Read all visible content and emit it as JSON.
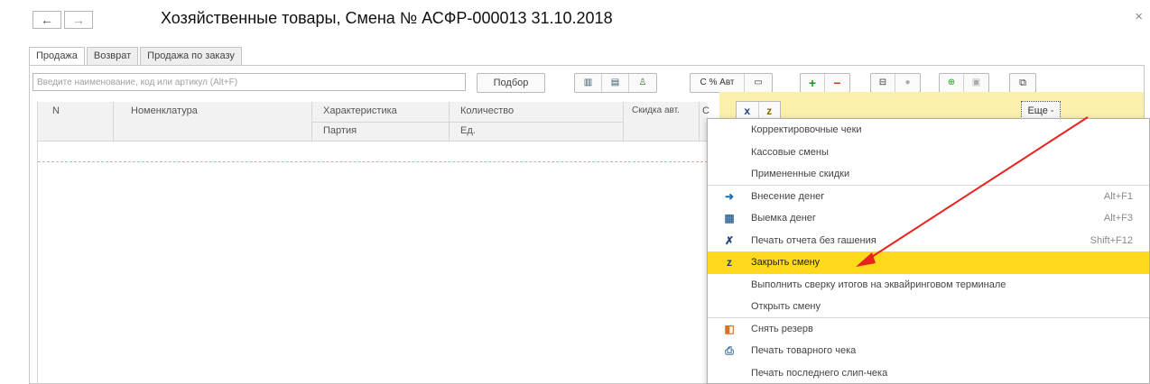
{
  "header": {
    "back_symbol": "←",
    "forward_symbol": "→",
    "title": "Хозяйственные товары, Смена № АСФР-000013  31.10.2018",
    "close_symbol": "×"
  },
  "tabs": [
    {
      "label": "Продажа"
    },
    {
      "label": "Возврат"
    },
    {
      "label": "Продажа по заказу"
    }
  ],
  "toolbar": {
    "search_placeholder": "Введите наименование, код или артикул (Alt+F)",
    "podbor_label": "Подбор",
    "discount_label": "С % Авт",
    "plus_symbol": "+",
    "minus_symbol": "−"
  },
  "grid": {
    "col_n": "N",
    "col_nomenclature": "Номенклатура",
    "col_characteristic": "Характеристика",
    "col_batch": "Партия",
    "col_quantity": "Количество",
    "col_unit": "Ед.",
    "col_discount": "Скидка авт.",
    "col_cut": "С"
  },
  "side": {
    "excel_icon_glyph": "x",
    "close_shift_icon_glyph": "z",
    "more_label": "Еще -"
  },
  "menu": {
    "items": [
      {
        "label": "Корректировочные чеки",
        "shortcut": "",
        "icon": "",
        "icon_name": ""
      },
      {
        "label": "Кассовые смены",
        "shortcut": "",
        "icon": "",
        "icon_name": ""
      },
      {
        "label": "Примененные скидки",
        "shortcut": "",
        "icon": "",
        "icon_name": ""
      },
      {
        "label": "Внесение денег",
        "shortcut": "Alt+F1",
        "icon": "➜",
        "icon_name": "cash-in-icon"
      },
      {
        "label": "Выемка денег",
        "shortcut": "Alt+F3",
        "icon": "▦",
        "icon_name": "cash-out-icon"
      },
      {
        "label": "Печать отчета без гашения",
        "shortcut": "Shift+F12",
        "icon": "✗",
        "icon_name": "x-report-icon"
      },
      {
        "label": "Закрыть смену",
        "shortcut": "",
        "icon": "z",
        "icon_name": "close-shift-icon"
      },
      {
        "label": "Выполнить сверку итогов на эквайринговом терминале",
        "shortcut": "",
        "icon": "",
        "icon_name": ""
      },
      {
        "label": "Открыть смену",
        "shortcut": "",
        "icon": "",
        "icon_name": ""
      },
      {
        "label": "Снять резерв",
        "shortcut": "",
        "icon": "◧",
        "icon_name": "remove-reserve-icon"
      },
      {
        "label": "Печать товарного чека",
        "shortcut": "",
        "icon": "⎙",
        "icon_name": "print-icon"
      },
      {
        "label": "Печать последнего слип-чека",
        "shortcut": "",
        "icon": "",
        "icon_name": ""
      }
    ]
  },
  "colors": {
    "highlight": "#ffd91c",
    "yellow_panel": "#fbefac",
    "arrow": "#e8231f"
  }
}
